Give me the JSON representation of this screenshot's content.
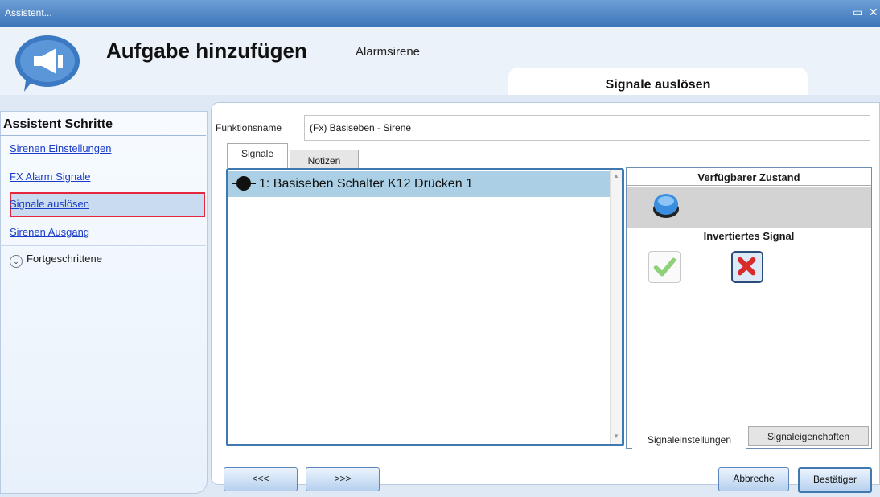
{
  "window": {
    "title": "Assistent..."
  },
  "header": {
    "title": "Aufgabe hinzufügen",
    "subtitle": "Alarmsirene",
    "tab_banner": "Signale auslösen"
  },
  "sidebar": {
    "title": "Assistent Schritte",
    "items": [
      {
        "label": "Sirenen Einstellungen"
      },
      {
        "label": "FX Alarm Signale"
      },
      {
        "label": "Signale auslösen",
        "selected": true
      },
      {
        "label": "Sirenen Ausgang"
      }
    ],
    "advanced": "Fortgeschrittene"
  },
  "form": {
    "function_name_label": "Funktionsname",
    "function_name_value": "(Fx) Basiseben - Sirene"
  },
  "tabs": {
    "signals": "Signale",
    "notes": "Notizen"
  },
  "signals": [
    {
      "label": "1: Basiseben Schalter K12 Drücken 1"
    }
  ],
  "right_panel": {
    "available_state": "Verfügbarer Zustand",
    "inverted_signal": "Invertiertes Signal",
    "tab_settings": "Signaleinstellungen",
    "tab_properties": "Signaleigenchaften"
  },
  "buttons": {
    "back": "<<<",
    "next": ">>>",
    "cancel": "Abbreche",
    "confirm": "Bestätiger"
  },
  "colors": {
    "titlebar": "#3c74b8",
    "selected_row": "#abd0e5",
    "highlight_border": "#e5273e"
  }
}
